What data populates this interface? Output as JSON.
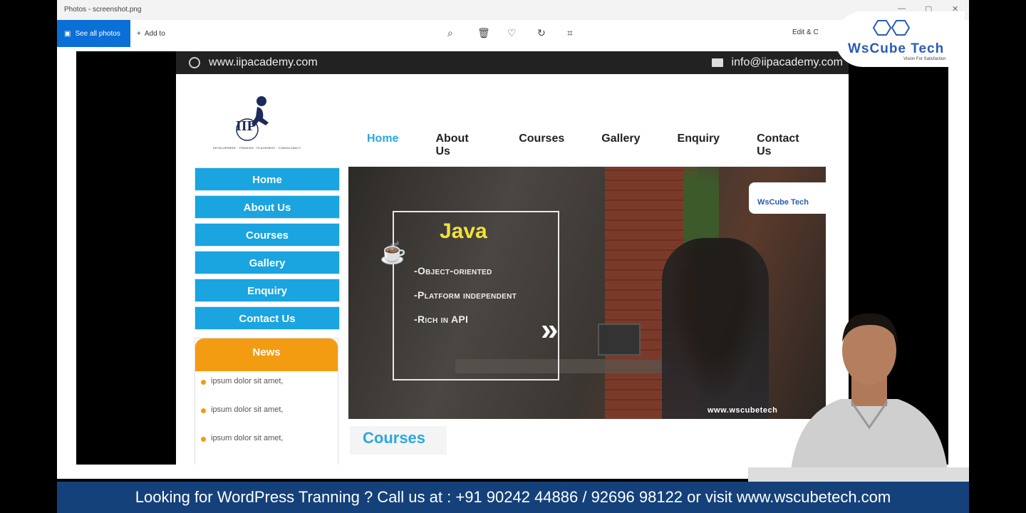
{
  "window": {
    "title": "Photos - screenshot.png"
  },
  "toolbar": {
    "see_all": "See all photos",
    "add_to": "Add to",
    "edit": "Edit & C"
  },
  "site": {
    "url": "www.iipacademy.com",
    "email": "info@iipacademy.com",
    "logo_text": "IIP",
    "logo_sub": "DEVELOPMENT · TRAINING · PLACEMENT · CONSULTANCY",
    "nav": [
      "Home",
      "About Us",
      "Courses",
      "Gallery",
      "Enquiry",
      "Contact Us"
    ],
    "sidebar": [
      "Home",
      "About Us",
      "Courses",
      "Gallery",
      "Enquiry",
      "Contact Us"
    ],
    "news": {
      "title": "News",
      "items": [
        "ipsum dolor sit amet,",
        "ipsum dolor sit amet,",
        "ipsum dolor sit amet,"
      ]
    },
    "banner": {
      "title": "Java",
      "points": [
        "-Object-oriented",
        "-Platform independent",
        "-Rich in API"
      ],
      "logo": "WsCube Tech",
      "url": "www.wscubetech"
    },
    "courses_heading": "Courses"
  },
  "brand": {
    "name": "WsCube Tech",
    "tagline": "Vision For Satisfaction"
  },
  "ticker": {
    "text": "Looking for WordPress Tranning ? Call us at : +91 90242 44886 / 92696 98122 or visit www.wscubetech.com"
  },
  "colors": {
    "accent": "#1aa4e0",
    "news": "#f39c12",
    "ticker": "#15417a"
  }
}
